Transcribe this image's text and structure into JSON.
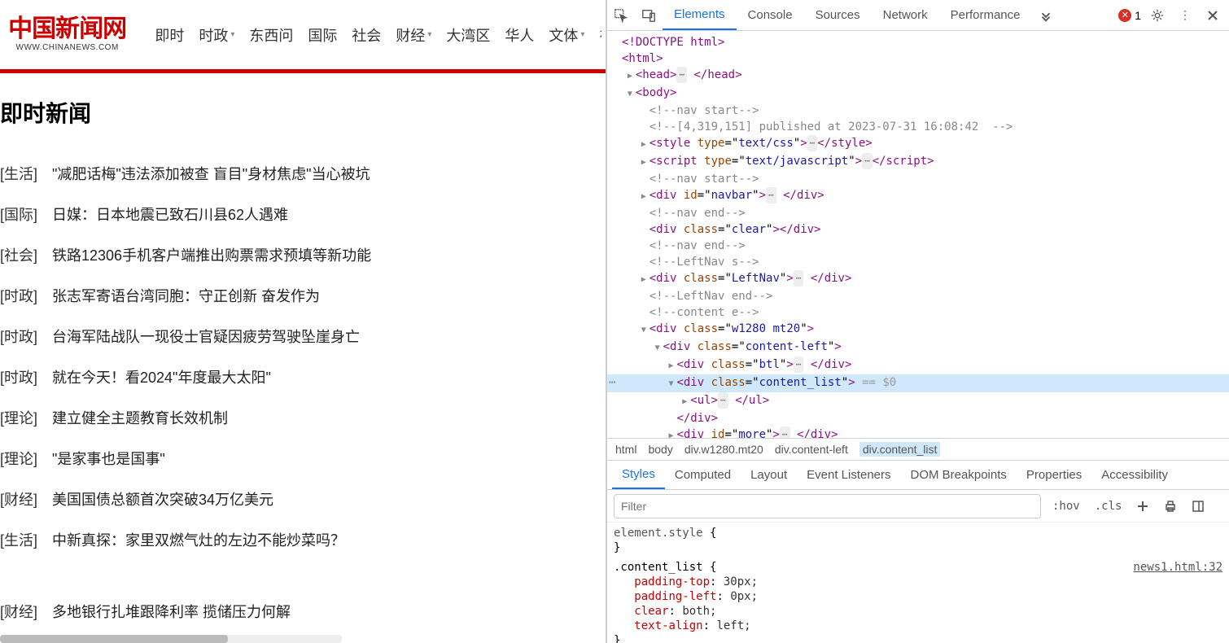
{
  "page": {
    "logo_cn": "中国新闻网",
    "logo_en": "WWW.CHINANEWS.COM",
    "menu": [
      "即时",
      "时政",
      "东西问",
      "国际",
      "社会",
      "财经",
      "大湾区",
      "华人",
      "文体",
      "视"
    ],
    "menu_dropdown": [
      false,
      true,
      false,
      false,
      false,
      true,
      false,
      false,
      true,
      false
    ],
    "title": "即时新闻",
    "news": [
      {
        "cat": "[生活]",
        "title": "\"减肥话梅\"违法添加被查 盲目\"身材焦虑\"当心被坑"
      },
      {
        "cat": "[国际]",
        "title": "日媒：日本地震已致石川县62人遇难"
      },
      {
        "cat": "[社会]",
        "title": "铁路12306手机客户端推出购票需求预填等新功能"
      },
      {
        "cat": "[时政]",
        "title": "张志军寄语台湾同胞：守正创新 奋发作为"
      },
      {
        "cat": "[时政]",
        "title": "台海军陆战队一现役士官疑因疲劳驾驶坠崖身亡"
      },
      {
        "cat": "[时政]",
        "title": "就在今天！看2024\"年度最大太阳\""
      },
      {
        "cat": "[理论]",
        "title": "建立健全主题教育长效机制"
      },
      {
        "cat": "[理论]",
        "title": "\"是家事也是国事\""
      },
      {
        "cat": "[财经]",
        "title": "美国国债总额首次突破34万亿美元"
      },
      {
        "cat": "[生活]",
        "title": "中新真探：家里双燃气灶的左边不能炒菜吗？"
      },
      {
        "cat": "[财经]",
        "title": "多地银行扎堆跟降利率 揽储压力何解"
      }
    ]
  },
  "devtools": {
    "tabs": [
      "Elements",
      "Console",
      "Sources",
      "Network",
      "Performance"
    ],
    "active_tab": "Elements",
    "error_count": "1",
    "dom_lines": [
      {
        "i": 0,
        "html": "<span class='t-tag'>&lt;!DOCTYPE html&gt;</span>"
      },
      {
        "i": 0,
        "html": "<span class='t-tag'>&lt;html&gt;</span>"
      },
      {
        "i": 1,
        "tri": "r",
        "html": "<span class='t-tag'>&lt;head&gt;</span><span class='ellip'>⋯</span> <span class='t-tag'>&lt;/head&gt;</span>"
      },
      {
        "i": 1,
        "tri": "d",
        "html": "<span class='t-tag'>&lt;body&gt;</span>"
      },
      {
        "i": 2,
        "html": "<span class='t-com'>&lt;!--nav start--&gt;</span>"
      },
      {
        "i": 2,
        "html": "<span class='t-com'>&lt;!--[4,319,151] published at 2023-07-31 16:08:42  --&gt;</span>"
      },
      {
        "i": 2,
        "tri": "r",
        "html": "<span class='t-tag'>&lt;style</span> <span class='t-attr'>type</span>=\"<span class='t-val'>text/css</span>\"<span class='t-tag'>&gt;</span><span class='ellip'>⋯</span><span class='t-tag'>&lt;/style&gt;</span>"
      },
      {
        "i": 2,
        "tri": "r",
        "html": "<span class='t-tag'>&lt;script</span> <span class='t-attr'>type</span>=\"<span class='t-val'>text/javascript</span>\"<span class='t-tag'>&gt;</span><span class='ellip'>⋯</span><span class='t-tag'>&lt;/script&gt;</span>"
      },
      {
        "i": 2,
        "html": "<span class='t-com'>&lt;!--nav start--&gt;</span>"
      },
      {
        "i": 2,
        "tri": "r",
        "html": "<span class='t-tag'>&lt;div</span> <span class='t-attr'>id</span>=\"<span class='t-val'>navbar</span>\"<span class='t-tag'>&gt;</span><span class='ellip'>⋯</span> <span class='t-tag'>&lt;/div&gt;</span>"
      },
      {
        "i": 2,
        "html": "<span class='t-com'>&lt;!--nav end--&gt;</span>"
      },
      {
        "i": 2,
        "html": "<span class='t-tag'>&lt;div</span> <span class='t-attr'>class</span>=\"<span class='t-val'>clear</span>\"<span class='t-tag'>&gt;&lt;/div&gt;</span>"
      },
      {
        "i": 2,
        "html": "<span class='t-com'>&lt;!--nav end--&gt;</span>"
      },
      {
        "i": 2,
        "html": "<span class='t-com'>&lt;!--LeftNav s--&gt;</span>"
      },
      {
        "i": 2,
        "tri": "r",
        "html": "<span class='t-tag'>&lt;div</span> <span class='t-attr'>class</span>=\"<span class='t-val'>LeftNav</span>\"<span class='t-tag'>&gt;</span><span class='ellip'>⋯</span> <span class='t-tag'>&lt;/div&gt;</span>"
      },
      {
        "i": 2,
        "html": "<span class='t-com'>&lt;!--LeftNav end--&gt;</span>"
      },
      {
        "i": 2,
        "html": "<span class='t-com'>&lt;!--content e--&gt;</span>"
      },
      {
        "i": 2,
        "tri": "d",
        "html": "<span class='t-tag'>&lt;div</span> <span class='t-attr'>class</span>=\"<span class='t-val'>w1280 mt20</span>\"<span class='t-tag'>&gt;</span>"
      },
      {
        "i": 3,
        "tri": "d",
        "html": "<span class='t-tag'>&lt;div</span> <span class='t-attr'>class</span>=\"<span class='t-val'>content-left</span>\"<span class='t-tag'>&gt;</span>"
      },
      {
        "i": 4,
        "tri": "r",
        "html": "<span class='t-tag'>&lt;div</span> <span class='t-attr'>class</span>=\"<span class='t-val'>btl</span>\"<span class='t-tag'>&gt;</span><span class='ellip'>⋯</span> <span class='t-tag'>&lt;/div&gt;</span>"
      },
      {
        "i": 4,
        "tri": "d",
        "sel": true,
        "gutter": "⋯",
        "html": "<span class='t-tag'>&lt;div</span> <span class='t-attr'>class</span>=\"<span class='t-val'>content_list</span>\"<span class='t-tag'>&gt;</span> <span class='t-eq'>== $0</span>"
      },
      {
        "i": 5,
        "tri": "r",
        "html": "<span class='t-tag'>&lt;ul&gt;</span><span class='ellip'>⋯</span> <span class='t-tag'>&lt;/ul&gt;</span>"
      },
      {
        "i": 4,
        "html": "<span class='t-tag'>&lt;/div&gt;</span>"
      },
      {
        "i": 4,
        "tri": "r",
        "html": "<span class='t-tag'>&lt;div</span> <span class='t-attr'>id</span>=\"<span class='t-val'>more</span>\"<span class='t-tag'>&gt;</span><span class='ellip'>⋯</span> <span class='t-tag'>&lt;/div&gt;</span>"
      },
      {
        "i": 3,
        "html": "<span class='t-tag'>&lt;/div&gt;</span>"
      }
    ],
    "crumbs": [
      "html",
      "body",
      "div.w1280.mt20",
      "div.content-left",
      "div.content_list"
    ],
    "subtabs": [
      "Styles",
      "Computed",
      "Layout",
      "Event Listeners",
      "DOM Breakpoints",
      "Properties",
      "Accessibility"
    ],
    "active_subtab": "Styles",
    "filter_placeholder": "Filter",
    "hov": ":hov",
    "cls": ".cls",
    "styles": {
      "es_label": "element.style",
      "rule_sel": ".content_list",
      "src": "news1.html:32",
      "props": [
        {
          "n": "padding-top",
          "v": "30px;"
        },
        {
          "n": "padding-left",
          "v": "0px;"
        },
        {
          "n": "clear",
          "v": "both;"
        },
        {
          "n": "text-align",
          "v": "left;"
        }
      ]
    }
  }
}
